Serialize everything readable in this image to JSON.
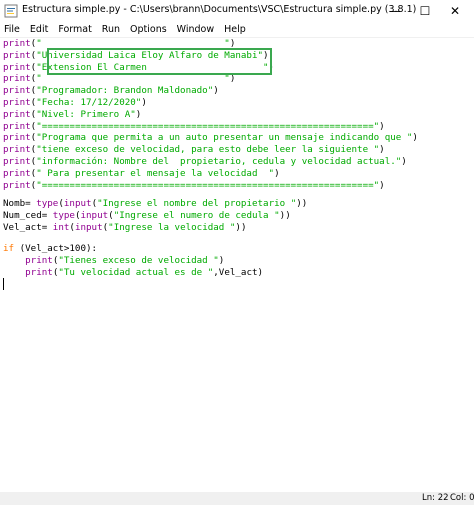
{
  "window": {
    "title": "Estructura simple.py - C:\\Users\\brann\\Documents\\VSC\\Estructura simple.py (3.8.1)",
    "minimize_glyph": "—",
    "maximize_glyph": "☐",
    "close_glyph": "✕"
  },
  "menu": [
    "File",
    "Edit",
    "Format",
    "Run",
    "Options",
    "Window",
    "Help"
  ],
  "code": {
    "l01": {
      "fn": "print",
      "open": "(",
      "str": "\"                                 \"",
      "close": ")"
    },
    "l02": {
      "fn": "print",
      "open": "(",
      "str": "\"Universidad Laica Eloy Alfaro de Manabi\"",
      "close": ")"
    },
    "l03": {
      "fn": "print",
      "open": "(",
      "str": "\"Extension El Carmen                     \"",
      "close": ")"
    },
    "l04": {
      "fn": "print",
      "open": "(",
      "str": "\"                                 \"",
      "close": ")"
    },
    "l05": {
      "fn": "print",
      "open": "(",
      "str": "\"Programador: Brandon Maldonado\"",
      "close": ")"
    },
    "l06": {
      "fn": "print",
      "open": "(",
      "str": "\"Fecha: 17/12/2020\"",
      "close": ")"
    },
    "l07": {
      "fn": "print",
      "open": "(",
      "str": "\"Nivel: Primero A\"",
      "close": ")"
    },
    "l08": {
      "fn": "print",
      "open": "(",
      "str": "\"============================================================\"",
      "close": ")"
    },
    "l09": {
      "fn": "print",
      "open": "(",
      "str": "\"Programa que permita a un auto presentar un mensaje indicando que \"",
      "close": ")"
    },
    "l10": {
      "fn": "print",
      "open": "(",
      "str": "\"tiene exceso de velocidad, para esto debe leer la siguiente \"",
      "close": ")"
    },
    "l11": {
      "fn": "print",
      "open": "(",
      "str": "\"información: Nombre del  propietario, cedula y velocidad actual.\"",
      "close": ")"
    },
    "l12": {
      "fn": "print",
      "open": "(",
      "str": "\" Para presentar el mensaje la velocidad  \"",
      "close": ")"
    },
    "l13": {
      "fn": "print",
      "open": "(",
      "str": "\"============================================================\"",
      "close": ")"
    },
    "l15": {
      "pre": "Nomb= ",
      "f1": "type",
      "mid": "(",
      "f2": "input",
      "open": "(",
      "str": "\"Ingrese el nombre del propietario \"",
      "close": "))"
    },
    "l16": {
      "pre": "Num_ced= ",
      "f1": "type",
      "mid": "(",
      "f2": "input",
      "open": "(",
      "str": "\"Ingrese el numero de cedula \"",
      "close": "))"
    },
    "l17": {
      "pre": "Vel_act= ",
      "f1": "int",
      "mid": "(",
      "f2": "input",
      "open": "(",
      "str": "\"Ingrese la velocidad \"",
      "close": "))"
    },
    "l19": {
      "kw": "if",
      "rest": " (Vel_act>100):"
    },
    "l20": {
      "indent": "    ",
      "fn": "print",
      "open": "(",
      "str": "\"Tienes exceso de velocidad \"",
      "close": ")"
    },
    "l21": {
      "indent": "    ",
      "fn": "print",
      "open": "(",
      "str": "\"Tu velocidad actual es de \"",
      "close": ",Vel_act)"
    }
  },
  "status": {
    "line": "Ln: 22",
    "col": "Col: 0"
  }
}
